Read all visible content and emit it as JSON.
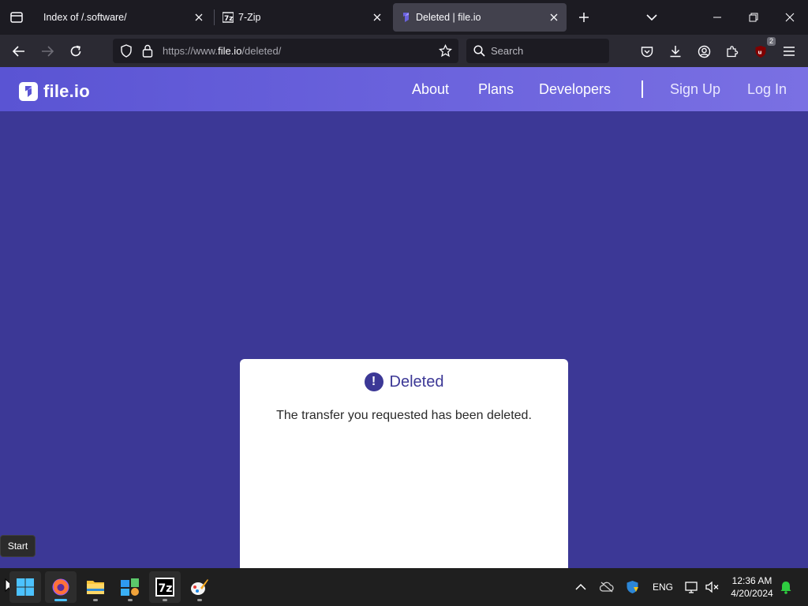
{
  "browser": {
    "tabs": [
      {
        "title": "Index of /.software/",
        "active": false
      },
      {
        "title": "7-Zip",
        "active": false
      },
      {
        "title": "Deleted | file.io",
        "active": true
      }
    ],
    "url": {
      "prefix": "https://www.",
      "host": "file.io",
      "path": "/deleted/"
    },
    "search_placeholder": "Search",
    "extension_badge": "2"
  },
  "site": {
    "brand": "file.io",
    "nav": {
      "about": "About",
      "plans": "Plans",
      "developers": "Developers",
      "signup": "Sign Up",
      "login": "Log In"
    },
    "card": {
      "icon_glyph": "!",
      "title": "Deleted",
      "message": "The transfer you requested has been deleted."
    },
    "colors": {
      "page_bg": "#3c3896",
      "header": "#6a62dc",
      "card": "#ffffff"
    }
  },
  "taskbar": {
    "start_tooltip": "Start",
    "language": "ENG",
    "time": "12:36 AM",
    "date": "4/20/2024"
  }
}
